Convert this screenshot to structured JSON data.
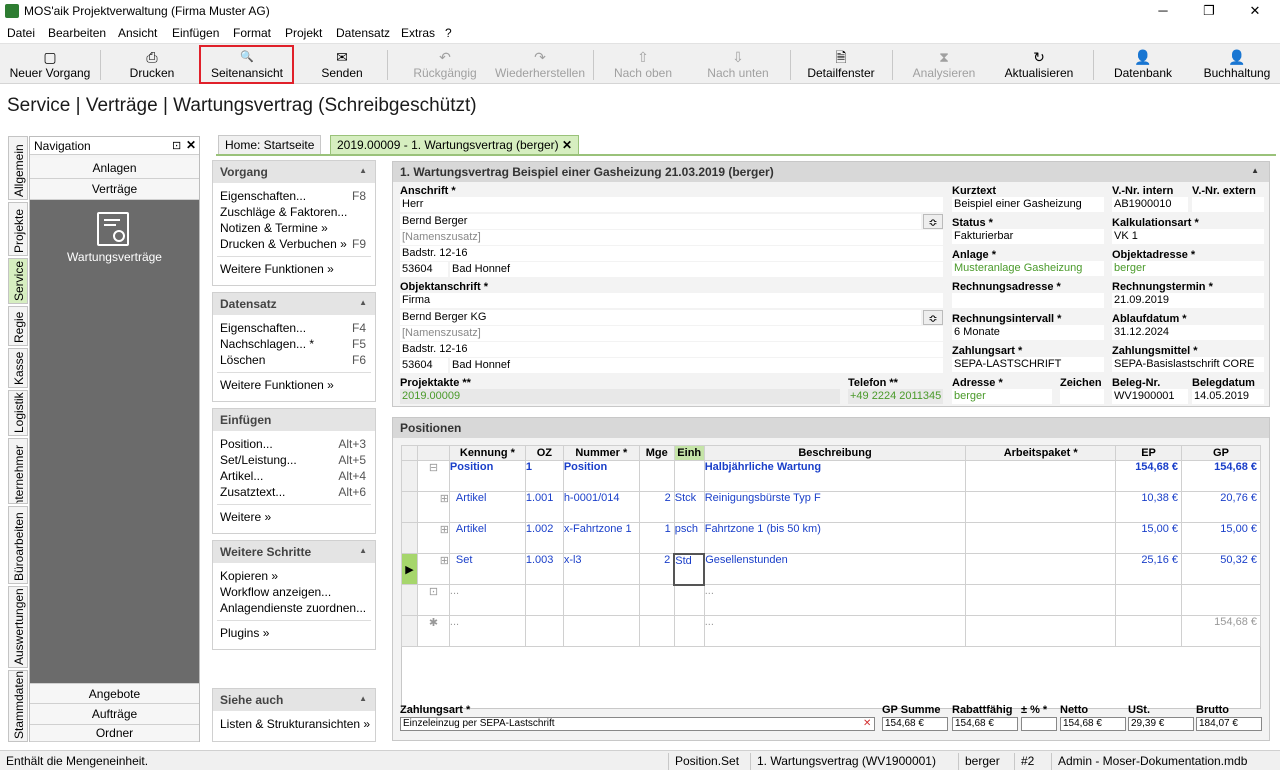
{
  "app": {
    "title": "MOS'aik Projektverwaltung (Firma Muster AG)",
    "min": "─",
    "max": "❐",
    "close": "✕"
  },
  "menu": [
    "Datei",
    "Bearbeiten",
    "Ansicht",
    "Einfügen",
    "Format",
    "Projekt",
    "Datensatz",
    "Extras",
    "?"
  ],
  "toolbar": [
    {
      "label": "Neuer Vorgang",
      "icon": "▢",
      "disabled": false
    },
    {
      "label": "Drucken",
      "icon": "⎙",
      "disabled": false
    },
    {
      "label": "Seitenansicht",
      "icon": "🔍",
      "disabled": false
    },
    {
      "label": "Senden",
      "icon": "✉",
      "disabled": false
    },
    {
      "label": "Rückgängig",
      "icon": "↶",
      "disabled": true
    },
    {
      "label": "Wiederherstellen",
      "icon": "↷",
      "disabled": true
    },
    {
      "label": "Nach oben",
      "icon": "⇧",
      "disabled": true
    },
    {
      "label": "Nach unten",
      "icon": "⇩",
      "disabled": true
    },
    {
      "label": "Detailfenster",
      "icon": "🗎",
      "disabled": false
    },
    {
      "label": "Analysieren",
      "icon": "⧗",
      "disabled": true
    },
    {
      "label": "Aktualisieren",
      "icon": "↻",
      "disabled": false
    },
    {
      "label": "Datenbank",
      "icon": "👤",
      "disabled": false
    },
    {
      "label": "Buchhaltung",
      "icon": "👤",
      "disabled": false
    }
  ],
  "page_title": "Service | Verträge | Wartungsvertrag (Schreibgeschützt)",
  "sidetabs": [
    "Allgemein",
    "Projekte",
    "Service",
    "Regie",
    "Kasse",
    "Logistik",
    "Unternehmer",
    "Büroarbeiten",
    "Auswertungen",
    "Stammdaten"
  ],
  "nav": {
    "header": "Navigation",
    "pin": "⊡",
    "close": "✕",
    "top_items": [
      "Anlagen",
      "Verträge"
    ],
    "big_item": "Wartungsverträge",
    "bottom_items": [
      "Angebote",
      "Aufträge",
      "Ordner"
    ]
  },
  "functions": [
    {
      "title": "Vorgang",
      "items": [
        {
          "l": "Eigenschaften...",
          "k": "F8"
        },
        {
          "l": "Zuschläge & Faktoren...",
          "k": ""
        },
        {
          "l": "Notizen & Termine »",
          "k": ""
        },
        {
          "l": "Drucken & Verbuchen »",
          "k": "F9"
        }
      ],
      "more": "Weitere Funktionen »"
    },
    {
      "title": "Datensatz",
      "items": [
        {
          "l": "Eigenschaften...",
          "k": "F4"
        },
        {
          "l": "Nachschlagen... *",
          "k": "F5"
        },
        {
          "l": "Löschen",
          "k": "F6"
        }
      ],
      "more": "Weitere Funktionen »"
    },
    {
      "title": "Einfügen",
      "items": [
        {
          "l": "Position...",
          "k": "Alt+3"
        },
        {
          "l": "Set/Leistung...",
          "k": "Alt+5"
        },
        {
          "l": "Artikel...",
          "k": "Alt+4"
        },
        {
          "l": "Zusatztext...",
          "k": "Alt+6"
        }
      ],
      "more": "Weitere »"
    },
    {
      "title": "Weitere Schritte",
      "items": [
        {
          "l": "Kopieren »",
          "k": ""
        },
        {
          "l": "Workflow anzeigen...",
          "k": ""
        },
        {
          "l": "Anlagendienste zuordnen...",
          "k": ""
        }
      ],
      "more": "Plugins »"
    },
    {
      "title": "Siehe auch",
      "items": [
        {
          "l": "Listen & Strukturansichten »",
          "k": ""
        }
      ],
      "more": ""
    }
  ],
  "doc_tabs": [
    "Home: Startseite",
    "2019.00009 - 1. Wartungsvertrag (berger)"
  ],
  "header": {
    "title": "1. Wartungsvertrag Beispiel einer Gasheizung 21.03.2019 (berger)",
    "anschrift_l": "Anschrift *",
    "anschrift": [
      "Herr",
      "Bernd Berger",
      "[Namenszusatz]",
      "Badstr. 12-16"
    ],
    "plz": "53604",
    "ort": "Bad Honnef",
    "objekt_l": "Objektanschrift *",
    "objekt": [
      "Firma",
      "Bernd Berger KG",
      "[Namenszusatz]",
      "Badstr. 12-16"
    ],
    "oplz": "53604",
    "oort": "Bad Honnef",
    "projektakte_l": "Projektakte **",
    "projektakte": "2019.00009",
    "telefon_l": "Telefon **",
    "telefon": "+49 2224 2011345",
    "kurztext_l": "Kurztext",
    "kurztext": "Beispiel einer Gasheizung",
    "vnr_l": "V.-Nr. intern",
    "vnr": "AB1900010",
    "vnrx_l": "V.-Nr. extern",
    "vnrx": "",
    "status_l": "Status *",
    "status": "Fakturierbar",
    "kalk_l": "Kalkulationsart *",
    "kalk": "VK 1",
    "anlage_l": "Anlage *",
    "anlage": "Musteranlage Gasheizung",
    "objadr_l": "Objektadresse *",
    "objadr": "berger",
    "rechadr_l": "Rechnungsadresse *",
    "rechadr": "",
    "rechterm_l": "Rechnungstermin *",
    "rechterm": "21.09.2019",
    "rechint_l": "Rechnungsintervall *",
    "rechint": "6 Monate",
    "ablauf_l": "Ablaufdatum *",
    "ablauf": "31.12.2024",
    "zart_l": "Zahlungsart *",
    "zart": "SEPA-LASTSCHRIFT",
    "zmittel_l": "Zahlungsmittel *",
    "zmittel": "SEPA-Basislastschrift CORE",
    "adresse_l": "Adresse *",
    "adresse": "berger",
    "zeichen_l": "Zeichen",
    "zeichen": "",
    "beleg_l": "Beleg-Nr.",
    "beleg": "WV1900001",
    "belegdat_l": "Belegdatum",
    "belegdat": "14.05.2019"
  },
  "positions": {
    "title": "Positionen",
    "columns": [
      "Kennung *",
      "OZ",
      "Nummer *",
      "Mge",
      "Einh",
      "Beschreibung",
      "Arbeitspaket *",
      "EP",
      "GP"
    ],
    "rows": [
      {
        "k": "Position",
        "oz": "1",
        "nr": "Position",
        "mge": "",
        "einh": "",
        "desc": "Halbjährliche Wartung",
        "ap": "",
        "ep": "154,68 €",
        "gp": "154,68 €",
        "bold": true
      },
      {
        "k": "Artikel",
        "oz": "1.001",
        "nr": "h-0001/014",
        "mge": "2",
        "einh": "Stck",
        "desc": "Reinigungsbürste Typ F",
        "ap": "",
        "ep": "10,38 €",
        "gp": "20,76 €",
        "bold": false
      },
      {
        "k": "Artikel",
        "oz": "1.002",
        "nr": "x-Fahrtzone 1",
        "mge": "1",
        "einh": "psch",
        "desc": "Fahrtzone 1 (bis 50 km)",
        "ap": "",
        "ep": "15,00 €",
        "gp": "15,00 €",
        "bold": false
      },
      {
        "k": "Set",
        "oz": "1.003",
        "nr": "x-l3",
        "mge": "2",
        "einh": "Std",
        "desc": "Gesellenstunden",
        "ap": "",
        "ep": "25,16 €",
        "gp": "50,32 €",
        "bold": false
      },
      {
        "k": "...",
        "oz": "",
        "nr": "",
        "mge": "",
        "einh": "",
        "desc": "...",
        "ap": "",
        "ep": "",
        "gp": "",
        "bold": false
      },
      {
        "k": "...",
        "oz": "",
        "nr": "",
        "mge": "",
        "einh": "",
        "desc": "...",
        "ap": "",
        "ep": "",
        "gp": "154,68 €",
        "bold": false
      }
    ]
  },
  "footer": {
    "zart_l": "Zahlungsart *",
    "zart": "Einzeleinzug per SEPA-Lastschrift",
    "gps_l": "GP Summe",
    "gps": "154,68 €",
    "rabf_l": "Rabattfähig",
    "rabf": "154,68 €",
    "pm_l": "± % *",
    "pm": "",
    "netto_l": "Netto",
    "netto": "154,68 €",
    "ust_l": "USt.",
    "ust": "29,39 €",
    "brutto_l": "Brutto",
    "brutto": "184,07 €"
  },
  "status": {
    "msg": "Enthält die Mengeneinheit.",
    "s1": "Position.Set",
    "s2": "1. Wartungsvertrag (WV1900001)",
    "s3": "berger",
    "s4": "#2",
    "s5": "Admin - Moser-Dokumentation.mdb"
  }
}
